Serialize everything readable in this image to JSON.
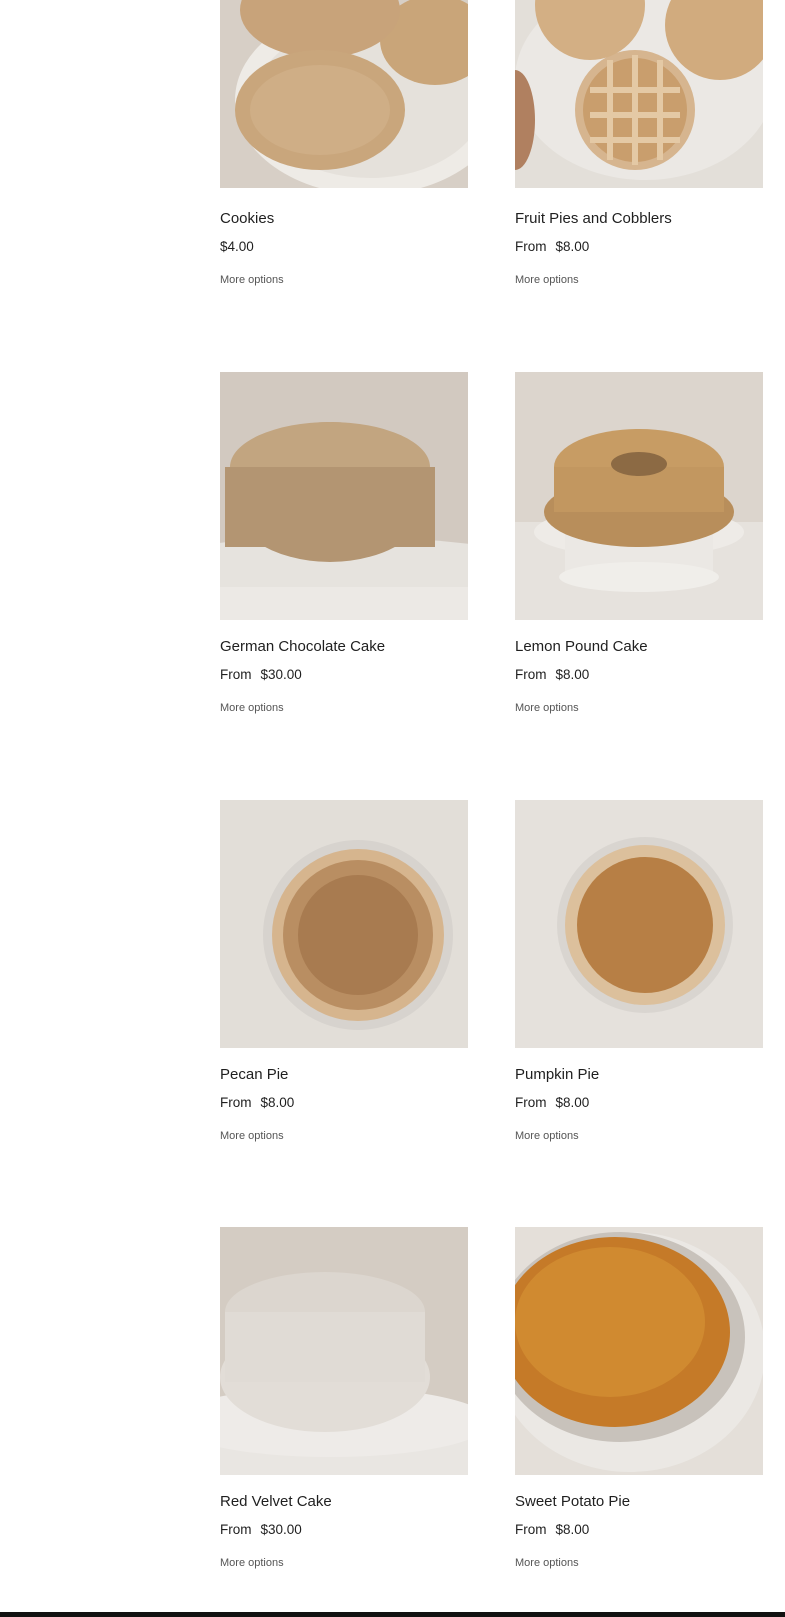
{
  "products": [
    {
      "name": "Cookies",
      "from": "",
      "price": "$4.00",
      "action": "More options"
    },
    {
      "name": "Fruit Pies and Cobblers",
      "from": "From",
      "price": "$8.00",
      "action": "More options"
    },
    {
      "name": "German Chocolate Cake",
      "from": "From",
      "price": "$30.00",
      "action": "More options"
    },
    {
      "name": "Lemon Pound Cake",
      "from": "From",
      "price": "$8.00",
      "action": "More options"
    },
    {
      "name": "Pecan Pie",
      "from": "From",
      "price": "$8.00",
      "action": "More options"
    },
    {
      "name": "Pumpkin Pie",
      "from": "From",
      "price": "$8.00",
      "action": "More options"
    },
    {
      "name": "Red Velvet Cake",
      "from": "From",
      "price": "$30.00",
      "action": "More options"
    },
    {
      "name": "Sweet Potato Pie",
      "from": "From",
      "price": "$8.00",
      "action": "More options"
    }
  ]
}
